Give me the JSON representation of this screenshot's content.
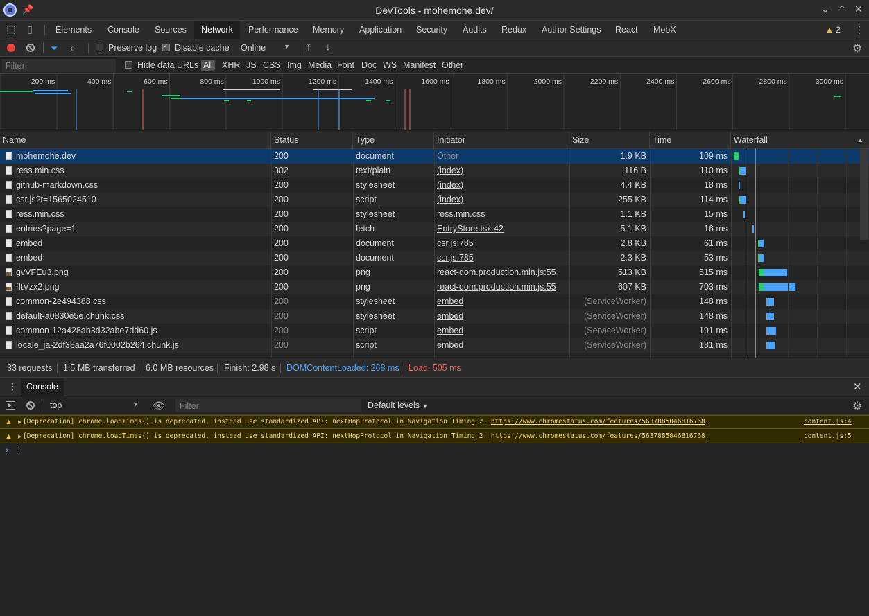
{
  "window": {
    "title": "DevTools - mohemohe.dev/"
  },
  "tabs": [
    "Elements",
    "Console",
    "Sources",
    "Network",
    "Performance",
    "Memory",
    "Application",
    "Security",
    "Audits",
    "Redux",
    "Author Settings",
    "React",
    "MobX"
  ],
  "active_tab": "Network",
  "warnings_count": "2",
  "toolbar": {
    "preserve_log": "Preserve log",
    "preserve_log_checked": false,
    "disable_cache": "Disable cache",
    "disable_cache_checked": true,
    "throttle": "Online"
  },
  "filter": {
    "placeholder": "Filter",
    "hide_data_urls": "Hide data URLs",
    "types": [
      "All",
      "XHR",
      "JS",
      "CSS",
      "Img",
      "Media",
      "Font",
      "Doc",
      "WS",
      "Manifest",
      "Other"
    ]
  },
  "overview_ticks": [
    "200 ms",
    "400 ms",
    "600 ms",
    "800 ms",
    "1000 ms",
    "1200 ms",
    "1400 ms",
    "1600 ms",
    "1800 ms",
    "2000 ms",
    "2200 ms",
    "2400 ms",
    "2600 ms",
    "2800 ms",
    "3000 ms"
  ],
  "columns": {
    "name": "Name",
    "status": "Status",
    "type": "Type",
    "initiator": "Initiator",
    "size": "Size",
    "time": "Time",
    "waterfall": "Waterfall"
  },
  "requests": [
    {
      "name": "mohemohe.dev",
      "status": "200",
      "type": "document",
      "initiator": "Other",
      "size": "1.9 KB",
      "time": "109 ms",
      "icon": "file-icon"
    },
    {
      "name": "ress.min.css",
      "status": "302",
      "type": "text/plain",
      "initiator": "(index)",
      "size": "116 B",
      "time": "110 ms",
      "icon": "file-icon"
    },
    {
      "name": "github-markdown.css",
      "status": "200",
      "type": "stylesheet",
      "initiator": "(index)",
      "size": "4.4 KB",
      "time": "18 ms",
      "icon": "file-icon"
    },
    {
      "name": "csr.js?t=1565024510",
      "status": "200",
      "type": "script",
      "initiator": "(index)",
      "size": "255 KB",
      "time": "114 ms",
      "icon": "file-icon"
    },
    {
      "name": "ress.min.css",
      "status": "200",
      "type": "stylesheet",
      "initiator": "ress.min.css",
      "size": "1.1 KB",
      "time": "15 ms",
      "icon": "file-icon"
    },
    {
      "name": "entries?page=1",
      "status": "200",
      "type": "fetch",
      "initiator": "EntryStore.tsx:42",
      "size": "5.1 KB",
      "time": "16 ms",
      "icon": "file-icon"
    },
    {
      "name": "embed",
      "status": "200",
      "type": "document",
      "initiator": "csr.js:785",
      "size": "2.8 KB",
      "time": "61 ms",
      "icon": "file-icon"
    },
    {
      "name": "embed",
      "status": "200",
      "type": "document",
      "initiator": "csr.js:785",
      "size": "2.3 KB",
      "time": "53 ms",
      "icon": "file-icon"
    },
    {
      "name": "gvVFEu3.png",
      "status": "200",
      "type": "png",
      "initiator": "react-dom.production.min.js:55",
      "size": "513 KB",
      "time": "515 ms",
      "icon": "image-icon"
    },
    {
      "name": "fItVzx2.png",
      "status": "200",
      "type": "png",
      "initiator": "react-dom.production.min.js:55",
      "size": "607 KB",
      "time": "703 ms",
      "icon": "image-icon"
    },
    {
      "name": "common-2e494388.css",
      "status": "200",
      "type": "stylesheet",
      "initiator": "embed",
      "size": "(ServiceWorker)",
      "time": "148 ms",
      "icon": "file-icon"
    },
    {
      "name": "default-a0830e5e.chunk.css",
      "status": "200",
      "type": "stylesheet",
      "initiator": "embed",
      "size": "(ServiceWorker)",
      "time": "148 ms",
      "icon": "file-icon"
    },
    {
      "name": "common-12a428ab3d32abe7dd60.js",
      "status": "200",
      "type": "script",
      "initiator": "embed",
      "size": "(ServiceWorker)",
      "time": "191 ms",
      "icon": "file-icon"
    },
    {
      "name": "locale_ja-2df38aa2a76f0002b264.chunk.js",
      "status": "200",
      "type": "script",
      "initiator": "embed",
      "size": "(ServiceWorker)",
      "time": "181 ms",
      "icon": "file-icon"
    }
  ],
  "status_bar": {
    "requests": "33 requests",
    "transferred": "1.5 MB transferred",
    "resources": "6.0 MB resources",
    "finish": "Finish: 2.98 s",
    "dom_content_loaded": "DOMContentLoaded: 268 ms",
    "load": "Load: 505 ms"
  },
  "drawer": {
    "tab": "Console"
  },
  "console": {
    "context": "top",
    "filter_placeholder": "Filter",
    "levels": "Default levels",
    "messages": [
      {
        "text": "[Deprecation] chrome.loadTimes() is deprecated, instead use standardized API: nextHopProtocol in Navigation Timing 2. ",
        "url": "https://www.chromestatus.com/features/5637885046816768",
        "tail": ".",
        "source": "content.js:4"
      },
      {
        "text": "[Deprecation] chrome.loadTimes() is deprecated, instead use standardized API: nextHopProtocol in Navigation Timing 2. ",
        "url": "https://www.chromestatus.com/features/5637885046816768",
        "tail": ".",
        "source": "content.js:5"
      }
    ]
  },
  "colors": {
    "accent": "#4aa3ff",
    "selected_row": "#0b3a6b",
    "record": "#e8453c",
    "warning_bg": "#332b00",
    "warning_text": "#f5d97a"
  }
}
